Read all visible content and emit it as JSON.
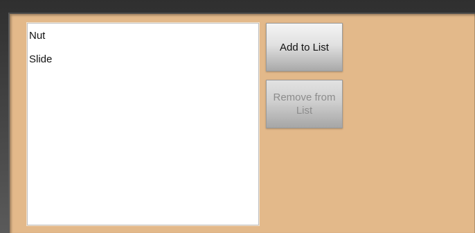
{
  "list": {
    "items": [
      "Nut",
      "Slide"
    ]
  },
  "buttons": {
    "add_label": "Add to List",
    "remove_label": "Remove from List",
    "remove_enabled": false
  },
  "colors": {
    "panel_background": "#e3b98a",
    "list_background": "#ffffff",
    "disabled_text": "#8c8c8c"
  }
}
